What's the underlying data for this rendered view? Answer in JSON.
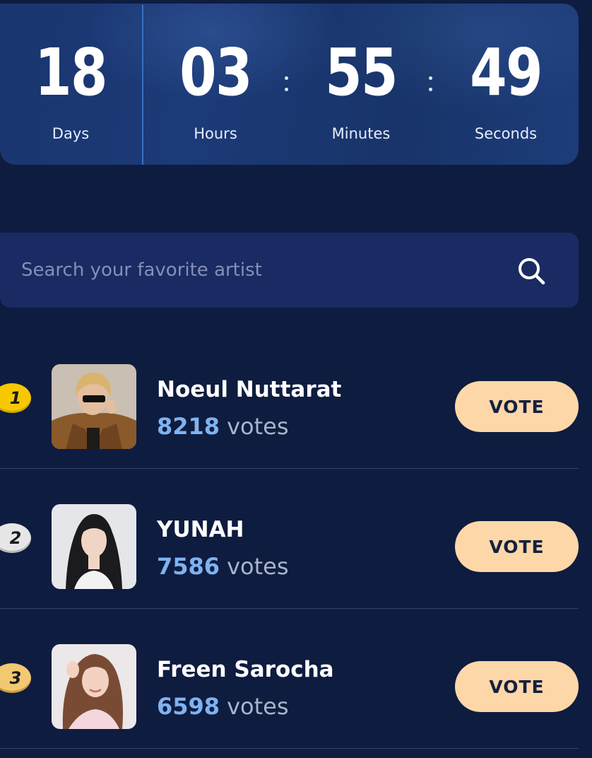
{
  "countdown": {
    "days": {
      "value": "18",
      "label": "Days"
    },
    "hours": {
      "value": "03",
      "label": "Hours"
    },
    "minutes": {
      "value": "55",
      "label": "Minutes"
    },
    "seconds": {
      "value": "49",
      "label": "Seconds"
    }
  },
  "search": {
    "placeholder": "Search your favorite artist",
    "icon": "search-icon"
  },
  "artists": [
    {
      "rank": "1",
      "name": "Noeul Nuttarat",
      "votes": "8218",
      "votes_label": "votes",
      "button": "VOTE",
      "badge_color": "#f5c800"
    },
    {
      "rank": "2",
      "name": "YUNAH",
      "votes": "7586",
      "votes_label": "votes",
      "button": "VOTE",
      "badge_color": "#e6e6e6"
    },
    {
      "rank": "3",
      "name": "Freen Sarocha",
      "votes": "6598",
      "votes_label": "votes",
      "button": "VOTE",
      "badge_color": "#f3c872"
    }
  ],
  "colors": {
    "background": "#0e1c40",
    "accent_votes": "#7fb2f0",
    "vote_button": "#fdd7a8"
  }
}
